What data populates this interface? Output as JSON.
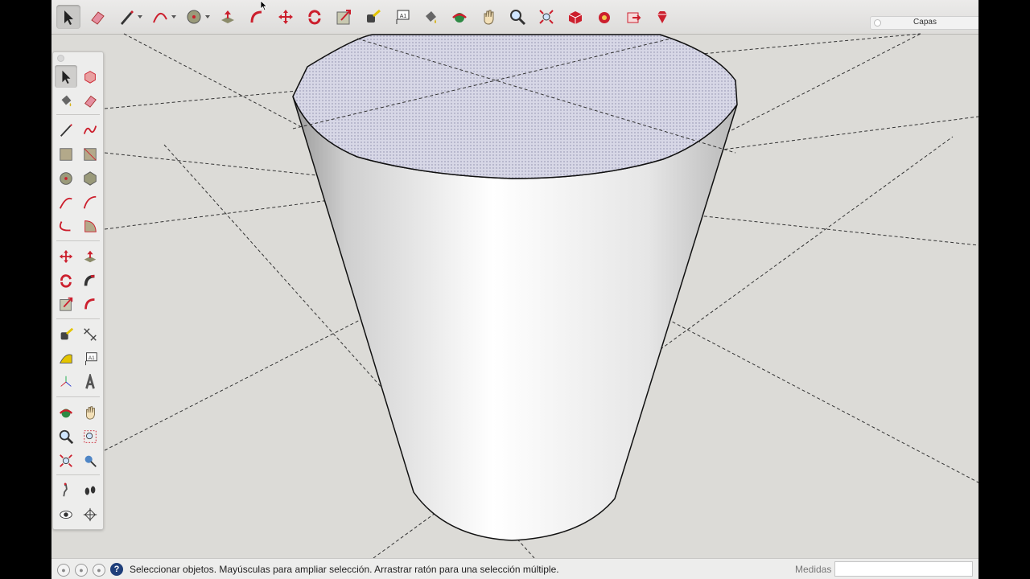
{
  "toolbar": {
    "tools": [
      {
        "name": "select-tool",
        "icon": "arrow-icon",
        "active": true
      },
      {
        "name": "eraser-tool",
        "icon": "eraser-icon"
      },
      {
        "name": "pencil-tool",
        "icon": "pencil-icon",
        "dropdown": true
      },
      {
        "name": "arc-tool",
        "icon": "arc-icon",
        "dropdown": true
      },
      {
        "name": "circle-tool",
        "icon": "circle-icon",
        "dropdown": true
      },
      {
        "name": "push-pull-tool",
        "icon": "push-pull-icon"
      },
      {
        "name": "follow-me-tool",
        "icon": "follow-me-icon"
      },
      {
        "name": "move-tool",
        "icon": "move-icon"
      },
      {
        "name": "rotate-tool",
        "icon": "rotate-icon"
      },
      {
        "name": "scale-tool",
        "icon": "scale-icon"
      },
      {
        "name": "tape-measure-tool",
        "icon": "tape-measure-icon"
      },
      {
        "name": "text-tool",
        "icon": "text-icon"
      },
      {
        "name": "paint-bucket-tool",
        "icon": "paint-bucket-icon"
      },
      {
        "name": "orbit-tool",
        "icon": "orbit-icon"
      },
      {
        "name": "pan-tool",
        "icon": "hand-icon"
      },
      {
        "name": "zoom-tool",
        "icon": "magnifier-icon"
      },
      {
        "name": "zoom-extents-tool",
        "icon": "zoom-extents-icon"
      },
      {
        "name": "3d-warehouse-tool",
        "icon": "warehouse-icon"
      },
      {
        "name": "extension-warehouse-tool",
        "icon": "extension-icon"
      },
      {
        "name": "share-model-tool",
        "icon": "share-icon"
      },
      {
        "name": "ruby-console-tool",
        "icon": "ruby-icon"
      }
    ]
  },
  "layers_panel": {
    "title": "Capas"
  },
  "palette": {
    "groups": [
      [
        "select",
        "make-component"
      ],
      [
        "paint-bucket",
        "eraser"
      ],
      [
        "line",
        "freehand"
      ],
      [
        "rectangle",
        "rotated-rectangle"
      ],
      [
        "circle",
        "polygon"
      ],
      [
        "arc",
        "two-point-arc"
      ],
      [
        "three-point-arc",
        "pie"
      ],
      [
        "move",
        "push-pull"
      ],
      [
        "rotate",
        "follow-me"
      ],
      [
        "scale",
        "offset"
      ],
      [
        "tape-measure",
        "dimension"
      ],
      [
        "protractor",
        "text"
      ],
      [
        "axes",
        "3d-text"
      ],
      [
        "orbit",
        "pan"
      ],
      [
        "zoom",
        "zoom-window"
      ],
      [
        "zoom-extents",
        "position-camera"
      ],
      [
        "walk",
        "look-around"
      ],
      [
        "section-plane",
        "section-display"
      ]
    ]
  },
  "statusbar": {
    "help_symbol": "?",
    "message": "Seleccionar objetos. Mayúsculas para ampliar selección. Arrastrar ratón para una selección múltiple.",
    "measure_label": "Medidas",
    "measure_value": ""
  },
  "colors": {
    "accent_red": "#cc1f2d",
    "viewport_bg": "#dcdbd7",
    "top_face": "#cfd0e0"
  }
}
